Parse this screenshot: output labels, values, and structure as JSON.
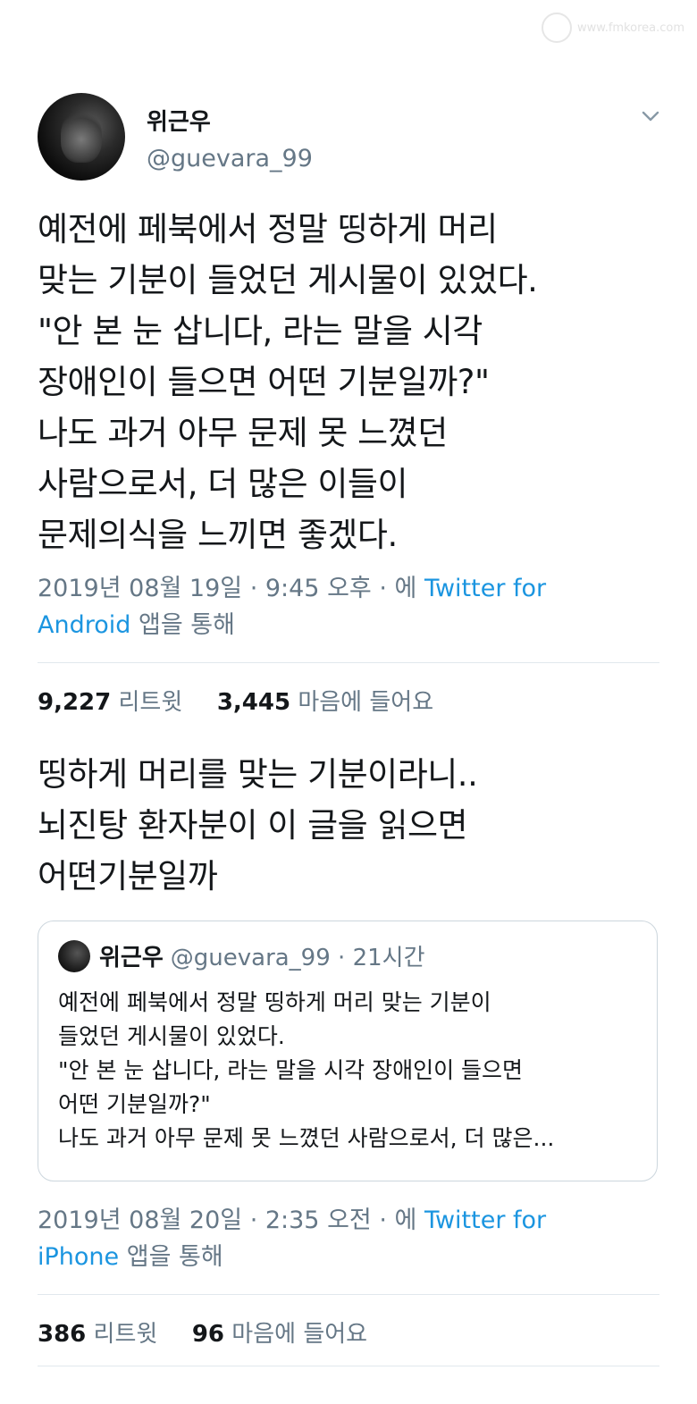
{
  "watermark": "www.fmkorea.com",
  "tweet": {
    "author_name": "위근우",
    "author_handle": "@guevara_99",
    "menu_icon": "chevron-down-icon",
    "text": "예전에 페북에서 정말 띵하게 머리\n맞는 기분이 들었던 게시물이 있었다.\n\"안 본 눈 삽니다, 라는 말을 시각\n장애인이 들으면 어떤 기분일까?\"\n나도 과거 아무 문제 못 느꼈던\n사람으로서, 더 많은 이들이\n문제의식을 느끼면 좋겠다.",
    "date": "2019년 08월 19일 · 9:45 오후 · 에 ",
    "source_a": "Twitter for",
    "source_b": "Android",
    "suffix": " 앱을 통해",
    "retweets": "9,227",
    "retweets_label": "리트윗",
    "likes": "3,445",
    "likes_label": "마음에 들어요"
  },
  "reply": {
    "text": "띵하게 머리를 맞는 기분이라니..\n뇌진탕 환자분이 이 글을 읽으면\n어떤기분일까",
    "quote": {
      "author_name": "위근우",
      "author_handle": "@guevara_99 · 21시간",
      "text": "예전에 페북에서 정말 띵하게 머리 맞는 기분이\n들었던 게시물이 있었다.\n\"안 본 눈 삽니다, 라는 말을 시각 장애인이 들으면\n어떤 기분일까?\"\n나도 과거 아무 문제 못 느꼈던 사람으로서, 더 많은..."
    },
    "date": "2019년 08월 20일 · 2:35 오전 · 에 ",
    "source_a": "Twitter for",
    "source_b": "iPhone",
    "suffix": " 앱을 통해",
    "retweets": "386",
    "retweets_label": "리트윗",
    "likes": "96",
    "likes_label": "마음에 들어요"
  },
  "colors": {
    "text": "#14171a",
    "secondary": "#657786",
    "link": "#1b95e0",
    "divider": "#e1e8ed"
  }
}
